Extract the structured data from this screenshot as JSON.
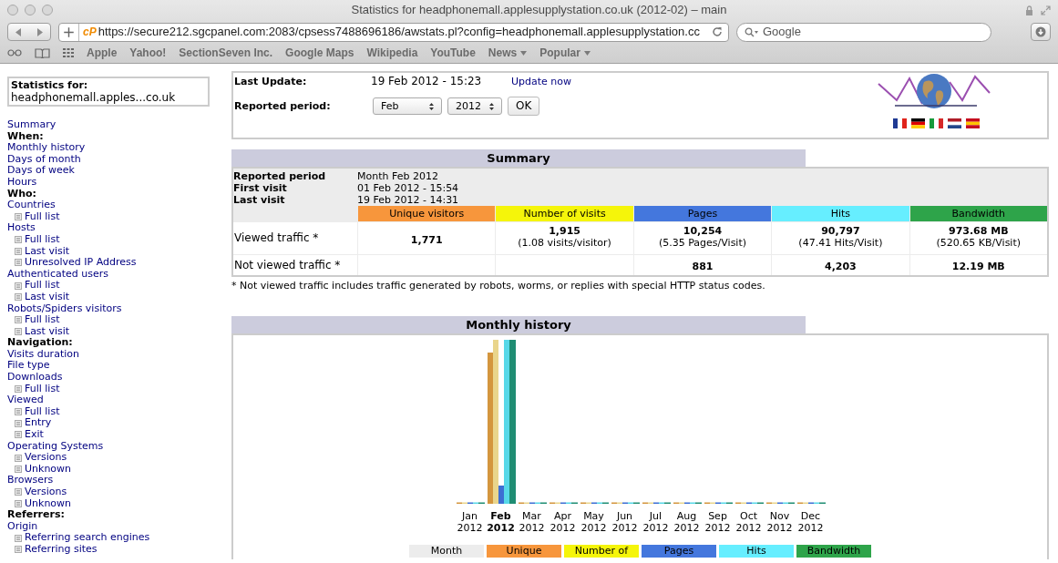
{
  "window": {
    "title": "Statistics for headphonemall.applesupplystation.co.uk (2012-02) – main"
  },
  "toolbar": {
    "url": "https://secure212.sgcpanel.com:2083/cpsess7488696186/awstats.pl?config=headphonemall.applesupplystation.cc",
    "site_badge": "cP",
    "search_placeholder": "Google"
  },
  "bookmarks": [
    {
      "label": "Apple",
      "menu": false
    },
    {
      "label": "Yahoo!",
      "menu": false
    },
    {
      "label": "SectionSeven Inc.",
      "menu": false
    },
    {
      "label": "Google Maps",
      "menu": false
    },
    {
      "label": "Wikipedia",
      "menu": false
    },
    {
      "label": "YouTube",
      "menu": false
    },
    {
      "label": "News",
      "menu": true
    },
    {
      "label": "Popular",
      "menu": true
    }
  ],
  "sidebar": {
    "title": "Statistics for:",
    "site": "headphonemall.apples...co.uk",
    "items": [
      {
        "kind": "link",
        "label": "Summary"
      },
      {
        "kind": "heading",
        "label": "When:"
      },
      {
        "kind": "link",
        "label": "Monthly history"
      },
      {
        "kind": "link",
        "label": "Days of month"
      },
      {
        "kind": "link",
        "label": "Days of week"
      },
      {
        "kind": "link",
        "label": "Hours"
      },
      {
        "kind": "heading",
        "label": "Who:"
      },
      {
        "kind": "link",
        "label": "Countries",
        "children": [
          {
            "label": "Full list"
          }
        ]
      },
      {
        "kind": "link",
        "label": "Hosts",
        "children": [
          {
            "label": "Full list"
          },
          {
            "label": "Last visit"
          },
          {
            "label": "Unresolved IP Address"
          }
        ]
      },
      {
        "kind": "link",
        "label": "Authenticated users",
        "children": [
          {
            "label": "Full list"
          },
          {
            "label": "Last visit"
          }
        ]
      },
      {
        "kind": "link",
        "label": "Robots/Spiders visitors",
        "children": [
          {
            "label": "Full list"
          },
          {
            "label": "Last visit"
          }
        ]
      },
      {
        "kind": "heading",
        "label": "Navigation:"
      },
      {
        "kind": "link",
        "label": "Visits duration"
      },
      {
        "kind": "link",
        "label": "File type"
      },
      {
        "kind": "link",
        "label": "Downloads",
        "children": [
          {
            "label": "Full list"
          }
        ]
      },
      {
        "kind": "link",
        "label": "Viewed",
        "children": [
          {
            "label": "Full list"
          },
          {
            "label": "Entry"
          },
          {
            "label": "Exit"
          }
        ]
      },
      {
        "kind": "link",
        "label": "Operating Systems",
        "children": [
          {
            "label": "Versions"
          },
          {
            "label": "Unknown"
          }
        ]
      },
      {
        "kind": "link",
        "label": "Browsers",
        "children": [
          {
            "label": "Versions"
          },
          {
            "label": "Unknown"
          }
        ]
      },
      {
        "kind": "heading",
        "label": "Referrers:"
      },
      {
        "kind": "link",
        "label": "Origin",
        "children": [
          {
            "label": "Referring search engines"
          },
          {
            "label": "Referring sites"
          }
        ]
      }
    ]
  },
  "header": {
    "last_update_label": "Last Update:",
    "last_update": "19 Feb 2012 - 15:23",
    "update_link": "Update now",
    "period_label": "Reported period:",
    "month": "Feb",
    "year": "2012",
    "ok": "OK"
  },
  "summary": {
    "title": "Summary",
    "info": [
      {
        "label": "Reported period",
        "value": "Month Feb 2012"
      },
      {
        "label": "First visit",
        "value": "01 Feb 2012 - 15:54"
      },
      {
        "label": "Last visit",
        "value": "19 Feb 2012 - 14:31"
      }
    ],
    "columns": [
      {
        "label": "Unique visitors",
        "color": "#f7963c"
      },
      {
        "label": "Number of visits",
        "color": "#f5f50a"
      },
      {
        "label": "Pages",
        "color": "#4477dd"
      },
      {
        "label": "Hits",
        "color": "#66eeff"
      },
      {
        "label": "Bandwidth",
        "color": "#2ea44a"
      }
    ],
    "rows": [
      {
        "label": "Viewed traffic *",
        "cells": [
          {
            "value": "1,771"
          },
          {
            "value": "1,915",
            "sub": "(1.08 visits/visitor)"
          },
          {
            "value": "10,254",
            "sub": "(5.35 Pages/Visit)"
          },
          {
            "value": "90,797",
            "sub": "(47.41 Hits/Visit)"
          },
          {
            "value": "973.68 MB",
            "sub": "(520.65 KB/Visit)"
          }
        ]
      },
      {
        "label": "Not viewed traffic *",
        "cells": [
          {},
          {},
          {
            "value": "881"
          },
          {
            "value": "4,203"
          },
          {
            "value": "12.19 MB"
          }
        ]
      }
    ]
  },
  "footnote": "* Not viewed traffic includes traffic generated by robots, worms, or replies with special HTTP status codes.",
  "monthly": {
    "title": "Monthly history",
    "months": [
      {
        "month": "Jan",
        "year": "2012",
        "selected": false
      },
      {
        "month": "Feb",
        "year": "2012",
        "selected": true
      },
      {
        "month": "Mar",
        "year": "2012",
        "selected": false
      },
      {
        "month": "Apr",
        "year": "2012",
        "selected": false
      },
      {
        "month": "May",
        "year": "2012",
        "selected": false
      },
      {
        "month": "Jun",
        "year": "2012",
        "selected": false
      },
      {
        "month": "Jul",
        "year": "2012",
        "selected": false
      },
      {
        "month": "Aug",
        "year": "2012",
        "selected": false
      },
      {
        "month": "Sep",
        "year": "2012",
        "selected": false
      },
      {
        "month": "Oct",
        "year": "2012",
        "selected": false
      },
      {
        "month": "Nov",
        "year": "2012",
        "selected": false
      },
      {
        "month": "Dec",
        "year": "2012",
        "selected": false
      }
    ],
    "table_columns": [
      {
        "label": "Month",
        "color": "#ececec"
      },
      {
        "label": "Unique",
        "color": "#f7963c"
      },
      {
        "label": "Number of",
        "color": "#f5f50a"
      },
      {
        "label": "Pages",
        "color": "#4477dd"
      },
      {
        "label": "Hits",
        "color": "#66eeff"
      },
      {
        "label": "Bandwidth",
        "color": "#2ea44a"
      }
    ]
  }
}
